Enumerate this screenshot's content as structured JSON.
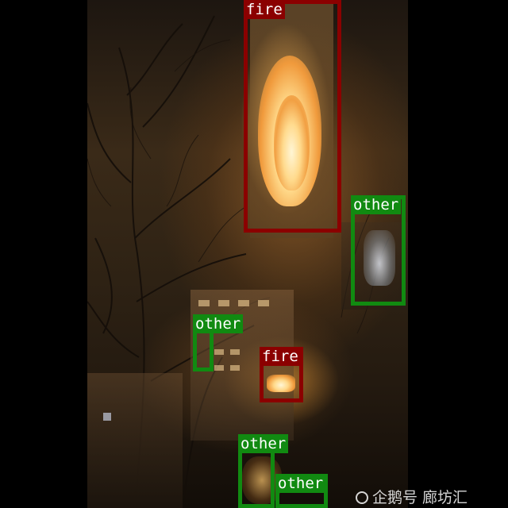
{
  "colors": {
    "fire": "#8b0000",
    "other": "#118a11"
  },
  "detections": [
    {
      "label": "fire",
      "class": "fire"
    },
    {
      "label": "other",
      "class": "other"
    },
    {
      "label": "other",
      "class": "other"
    },
    {
      "label": "fire",
      "class": "fire"
    },
    {
      "label": "other",
      "class": "other"
    },
    {
      "label": "other",
      "class": "other"
    }
  ],
  "watermark": {
    "text": "企鹅号 廊坊汇"
  }
}
